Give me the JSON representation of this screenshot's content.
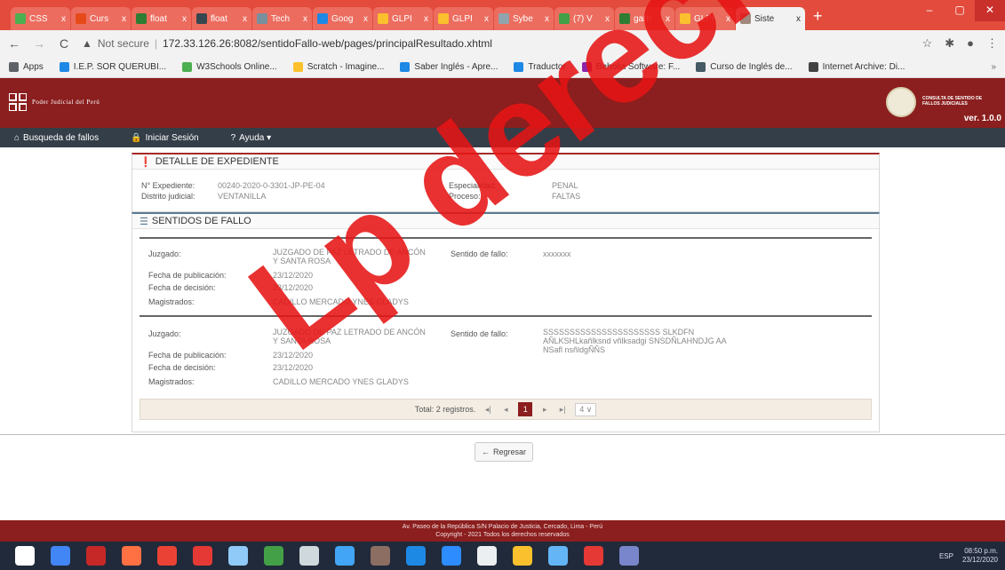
{
  "browser": {
    "tabs": [
      {
        "title": "CSS",
        "color": "#4caf50"
      },
      {
        "title": "Curs",
        "color": "#e64a19"
      },
      {
        "title": "float",
        "color": "#2e7d32"
      },
      {
        "title": "float",
        "color": "#37474f"
      },
      {
        "title": "Tech",
        "color": "#78909c"
      },
      {
        "title": "Goog",
        "color": "#1e88e5"
      },
      {
        "title": "GLPI",
        "color": "#fbc02d"
      },
      {
        "title": "GLPI",
        "color": "#fbc02d"
      },
      {
        "title": "Sybe",
        "color": "#90a4ae"
      },
      {
        "title": "(7) V",
        "color": "#43a047"
      },
      {
        "title": "garb",
        "color": "#2e7d32"
      },
      {
        "title": "GLPI",
        "color": "#fbc02d"
      },
      {
        "title": "Siste",
        "color": "#a1887f",
        "active": true
      }
    ],
    "close_glyph": "x",
    "new_tab": "+",
    "window_controls": {
      "minimize": "–",
      "maximize": "▢",
      "close": "✕"
    },
    "nav": {
      "back": "←",
      "forward": "→",
      "reload": "C"
    },
    "address": {
      "warning": "▲",
      "not_secure": "Not secure",
      "separator": "|",
      "url": "172.33.126.26:8082/sentidoFallo-web/pages/principalResultado.xhtml"
    },
    "right_icons": [
      "☆",
      "✱",
      "●",
      "⋮"
    ],
    "bookmarks": [
      {
        "label": "Apps",
        "color": "#5f6368"
      },
      {
        "label": "I.E.P. SOR QUERUBI...",
        "color": "#1e88e5"
      },
      {
        "label": "W3Schools Online...",
        "color": "#4caf50"
      },
      {
        "label": "Scratch - Imagine...",
        "color": "#fbc02d"
      },
      {
        "label": "Saber Inglés - Apre...",
        "color": "#1e88e5"
      },
      {
        "label": "Traductor",
        "color": "#1e88e5"
      },
      {
        "label": "Beholia Software: F...",
        "color": "#8e24aa"
      },
      {
        "label": "Curso de Inglés de...",
        "color": "#455a64"
      },
      {
        "label": "Internet Archive: Di...",
        "color": "#424242"
      }
    ],
    "bookmarks_more": "»"
  },
  "header": {
    "org_name": "Poder Judicial del Perú",
    "seal_text": "CONSULTA DE SENTIDO DE FALLOS JUDICIALES",
    "version": "ver. 1.0.0"
  },
  "navbar": [
    {
      "icon": "⌂",
      "label": "Busqueda de fallos"
    },
    {
      "icon": "🔒",
      "label": "Iniciar Sesión"
    },
    {
      "icon": "?",
      "label": "Ayuda ▾"
    }
  ],
  "detalle": {
    "title": "DETALLE DE EXPEDIENTE",
    "icon": "❗",
    "expediente_label": "N° Expediente:",
    "expediente_value": "00240-2020-0-3301-JP-PE-04",
    "distrito_label": "Distrito judicial:",
    "distrito_value": "VENTANILLA",
    "especialidad_label": "Especialidad:",
    "especialidad_value": "PENAL",
    "proceso_label": "Proceso:",
    "proceso_value": "FALTAS"
  },
  "sentidos": {
    "title": "SENTIDOS DE FALLO",
    "icon": "☰",
    "labels": {
      "juzgado": "Juzgado:",
      "fecha_pub": "Fecha de publicación:",
      "fecha_dec": "Fecha de decisión:",
      "magistrados": "Magistrados:",
      "sentido": "Sentido de fallo:"
    },
    "records": [
      {
        "juzgado": "JUZGADO DE PAZ LETRADO DE ANCÓN Y SANTA ROSA",
        "fecha_pub": "23/12/2020",
        "fecha_dec": "23/12/2020",
        "magistrados": "CADILLO MERCADO YNES GLADYS",
        "sentido": "xxxxxxx"
      },
      {
        "juzgado": "JUZGADO DE PAZ LETRADO DE ANCÓN Y SANTA ROSA",
        "fecha_pub": "23/12/2020",
        "fecha_dec": "23/12/2020",
        "magistrados": "CADILLO MERCADO YNES GLADYS",
        "sentido": "SSSSSSSSSSSSSSSSSSSSSS SLKDFN AÑLKSHLkañlksnd vñlksadgi SNSDÑLAHNDJG AA NSafl nsñldgÑÑS"
      }
    ],
    "pager": {
      "total": "Total: 2 registros.",
      "first": "◂|",
      "prev": "◂",
      "current": "1",
      "next": "▸",
      "last": "▸|",
      "per_page": "4 ∨"
    }
  },
  "regresar": {
    "icon": "←",
    "label": "Regresar"
  },
  "footer": {
    "line1": "Av. Paseo de la República S/N Palacio de Justicia, Cercado, Lima - Perú",
    "line2": "Copyright - 2021 Todos los derechos reservados"
  },
  "taskbar": {
    "icons": [
      {
        "name": "windows-start-icon",
        "color": "#ffffff"
      },
      {
        "name": "chrome-icon",
        "color": "#4285f4"
      },
      {
        "name": "filezilla-icon",
        "color": "#c62828"
      },
      {
        "name": "firefox-icon",
        "color": "#ff7043"
      },
      {
        "name": "google-icon",
        "color": "#ea4335"
      },
      {
        "name": "acrobat-icon",
        "color": "#e53935"
      },
      {
        "name": "cube-icon",
        "color": "#90caf9"
      },
      {
        "name": "project-icon",
        "color": "#43a047"
      },
      {
        "name": "db-icon",
        "color": "#cfd8dc"
      },
      {
        "name": "network-icon",
        "color": "#42a5f5"
      },
      {
        "name": "dev-icon",
        "color": "#8d6e63"
      },
      {
        "name": "edge-icon",
        "color": "#1e88e5"
      },
      {
        "name": "zoom-icon",
        "color": "#2d8cff"
      },
      {
        "name": "window-icon",
        "color": "#eceff1"
      },
      {
        "name": "folder-icon",
        "color": "#fbc02d"
      },
      {
        "name": "vbox-icon",
        "color": "#64b5f6"
      },
      {
        "name": "tool-icon",
        "color": "#e53935"
      },
      {
        "name": "control-icon",
        "color": "#7986cb"
      }
    ],
    "tray": {
      "lang": "ESP",
      "time": "08:50 p.m.",
      "date": "23/12/2020"
    }
  },
  "watermark": "Lp derecho"
}
